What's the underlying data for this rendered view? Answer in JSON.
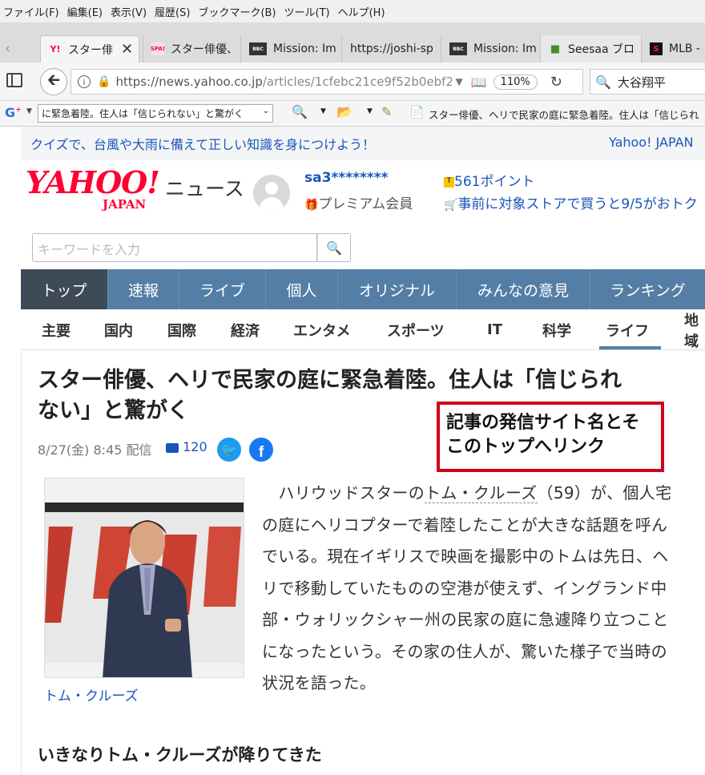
{
  "menu": [
    "ファイル(F)",
    "編集(E)",
    "表示(V)",
    "履歴(S)",
    "ブックマーク(B)",
    "ツール(T)",
    "ヘルプ(H)"
  ],
  "tabs": [
    {
      "title": "スター俳",
      "favicon": "Y!"
    },
    {
      "title": "スター俳優、",
      "favicon": "SPA!"
    },
    {
      "title": "Mission: Im",
      "favicon": "BBC"
    },
    {
      "title": "https://joshi-sp",
      "favicon": ""
    },
    {
      "title": "Mission: Im",
      "favicon": "BBC"
    },
    {
      "title": "Seesaa ブロ",
      "favicon": "book"
    },
    {
      "title": "MLB -",
      "favicon": "S"
    }
  ],
  "url": {
    "host": "https://news.yahoo.co.jp",
    "path": "/articles/1cfebc21ce9f52b0ebf2",
    "zoom": "110%"
  },
  "browser_search": "大谷翔平",
  "bookmarks": {
    "dropdown": "に緊急着陸。住人は「信じられない」と驚がく",
    "item": "スター俳優、ヘリで民家の庭に緊急着陸。住人は「信じられ"
  },
  "notice": {
    "text": "クイズで、台風や大雨に備えて正しい知識を身につけよう！",
    "right": "Yahoo! JAPAN"
  },
  "header": {
    "logo": "YAHOO!",
    "logo_sub": "JAPAN",
    "section": "ニュース",
    "username": "sa3********",
    "membership": "プレミアム会員",
    "points": "561ポイント",
    "promo": "事前に対象ストアで買うと9/5がおトク"
  },
  "search": {
    "placeholder": "キーワードを入力"
  },
  "main_nav": [
    "トップ",
    "速報",
    "ライブ",
    "個人",
    "オリジナル",
    "みんなの意見",
    "ランキング"
  ],
  "sub_nav": [
    "主要",
    "国内",
    "国際",
    "経済",
    "エンタメ",
    "スポーツ",
    "IT",
    "科学",
    "ライフ",
    "地域"
  ],
  "article": {
    "title_line1": "スター俳優、ヘリで民家の庭に緊急着陸。住人は「信じられ",
    "title_line2": "ない」と驚がく",
    "date": "8/27(金) 8:45 配信",
    "comments": "120",
    "image_caption": "トム・クルーズ",
    "para_pre": "ハリウッドスターの",
    "para_link": "トム・クルーズ",
    "para_post": "（59）が、個人宅の庭にヘリコプターで着陸したことが大きな話題を呼んでいる。現在イギリスで映画を撮影中のトムは先日、ヘリで移動していたものの空港が使えず、イングランド中部・ウォリックシャー州の民家の庭に急遽降り立つことになったという。その家の住人が、驚いた様子で当時の状況を語った。",
    "subheading": "いきなりトム・クルーズが降りてきた",
    "annotation": "記事の発信サイト名とそこのトップへリンク"
  },
  "colors": {
    "yahoo_red": "#ff0033",
    "nav_blue": "#547ea6",
    "nav_dark": "#3f4a58",
    "link": "#1a55b8",
    "annotation_border": "#d0021b"
  }
}
